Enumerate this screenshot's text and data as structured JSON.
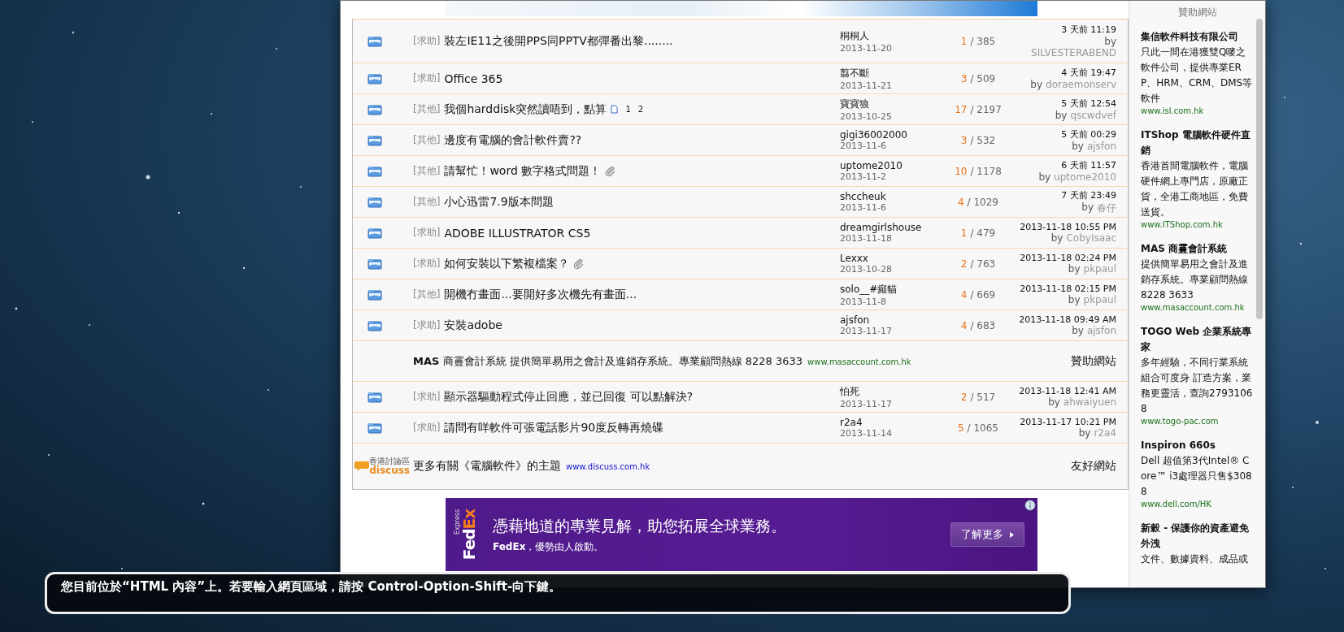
{
  "topics": [
    {
      "kind": "topic",
      "category": "[求助]",
      "title": "裝左IE11之後開PPS同PPTV都彈番出黎........",
      "author": "桐桐人",
      "date": "2013-11-20",
      "replies": "1",
      "views": "/ 385",
      "last_time": "3 天前 11:19",
      "by": "by",
      "last_user": "SILVESTERABEND"
    },
    {
      "kind": "topic",
      "category": "[求助]",
      "title": "Office 365",
      "author": "翦不斷",
      "date": "2013-11-21",
      "replies": "3",
      "views": "/ 509",
      "last_time": "4 天前 19:47",
      "by": "by",
      "last_user": "doraemonserv"
    },
    {
      "kind": "topic",
      "category": "[其他]",
      "title": "我個harddisk突然讀唔到，點算",
      "pages": [
        "1",
        "2"
      ],
      "author": "寶寶狼",
      "date": "2013-10-25",
      "replies": "17",
      "views": "/ 2197",
      "last_time": "5 天前 12:54",
      "by": "by",
      "last_user": "qscwdvef"
    },
    {
      "kind": "topic",
      "category": "[其他]",
      "title": "邊度有電腦的會計軟件賣??",
      "author": "gigi36002000",
      "date": "2013-11-6",
      "replies": "3",
      "views": "/ 532",
      "last_time": "5 天前 00:29",
      "by": "by",
      "last_user": "ajsfon"
    },
    {
      "kind": "topic",
      "category": "[其他]",
      "title": "請幫忙！word 數字格式問題！",
      "attachment": true,
      "author": "uptome2010",
      "date": "2013-11-2",
      "replies": "10",
      "views": "/ 1178",
      "last_time": "6 天前 11:57",
      "by": "by",
      "last_user": "uptome2010"
    },
    {
      "kind": "topic",
      "category": "[其他]",
      "title": "小心迅雷7.9版本問題",
      "author": "shccheuk",
      "date": "2013-11-6",
      "replies": "4",
      "views": "/ 1029",
      "last_time": "7 天前 23:49",
      "by": "by",
      "last_user": "春仔"
    },
    {
      "kind": "topic",
      "category": "[求助]",
      "title": "ADOBE ILLUSTRATOR CS5",
      "author": "dreamgirlshouse",
      "date": "2013-11-18",
      "replies": "1",
      "views": "/ 479",
      "last_time": "2013-11-18 10:55 PM",
      "by": "by",
      "last_user": "CobyIsaac"
    },
    {
      "kind": "topic",
      "category": "[求助]",
      "title": "如何安裝以下繁複檔案？",
      "attachment": true,
      "author": "Lexxx",
      "date": "2013-10-28",
      "replies": "2",
      "views": "/ 763",
      "last_time": "2013-11-18 02:24 PM",
      "by": "by",
      "last_user": "pkpaul"
    },
    {
      "kind": "topic",
      "category": "[其他]",
      "title": "開機冇畫面...要開好多次機先有畫面...",
      "author": "solo__#癲貓",
      "date": "2013-11-8",
      "replies": "4",
      "views": "/ 669",
      "last_time": "2013-11-18 02:15 PM",
      "by": "by",
      "last_user": "pkpaul"
    },
    {
      "kind": "topic",
      "category": "[求助]",
      "title": "安裝adobe",
      "author": "ajsfon",
      "date": "2013-11-17",
      "replies": "4",
      "views": "/ 683",
      "last_time": "2013-11-18 09:49 AM",
      "by": "by",
      "last_user": "ajsfon"
    },
    {
      "kind": "sponsor",
      "text": "**MAS** 商霻會計系統 提供簡單易用之會計及進銷存系統。專業顧問熱線 8228 3633",
      "url": "www.masaccount.com.hk",
      "label": "贊助網站"
    },
    {
      "kind": "topic",
      "category": "[求助]",
      "title": "顯示器驅動程式停止回應，並已回復 可以點解決?",
      "author": "怕死",
      "date": "2013-11-17",
      "replies": "2",
      "views": "/ 517",
      "last_time": "2013-11-18 12:41 AM",
      "by": "by",
      "last_user": "ahwaiyuen"
    },
    {
      "kind": "topic",
      "category": "[求助]",
      "title": "請問有咩軟件可張電話影片90度反轉再燒碟",
      "author": "r2a4",
      "date": "2013-11-14",
      "replies": "5",
      "views": "/ 1065",
      "last_time": "2013-11-17 10:21 PM",
      "by": "by",
      "last_user": "r2a4"
    }
  ],
  "footer": {
    "logo_top": "香港討論區",
    "logo_word": "discuss",
    "text": "更多有關《電腦軟件》的主題",
    "url": "www.discuss.com.hk",
    "label": "友好網站"
  },
  "ad": {
    "logo_parts": [
      "Fed",
      "Ex"
    ],
    "logo_sub": "Express",
    "headline": "憑藉地道的專業見解，助您拓展全球業務。",
    "sub": "**FedEx**，優勢由人啟動。",
    "button": "了解更多"
  },
  "sidebar": {
    "heading": "贊助網站",
    "items": [
      {
        "title": "集信軟件科技有限公司",
        "body": "只此一間在港獲雙Q嘜之軟件公司，提供專業ERP、HRM、CRM、DMS等軟件",
        "url": "www.isl.com.hk"
      },
      {
        "title": "ITShop 電腦軟件硬件直銷",
        "body": "香港首間電腦軟件，電腦硬件網上專門店，原廠正貨，全港工商地區，免費送貨。",
        "url": "www.ITShop.com.hk"
      },
      {
        "title": "MAS 商霻會計系統",
        "body": "提供簡單易用之會計及進銷存系統。專業顧問熱線 8228 3633",
        "url": "www.masaccount.com.hk"
      },
      {
        "title": "TOGO Web 企業系統專家",
        "body": "多年經驗，不同行業系統組合可度身 訂造方案，業務更靈活，查詢27931068",
        "url": "www.togo-pac.com"
      },
      {
        "title": "Inspiron 660s",
        "body": "Dell 超值第3代Intel® Core™ i3處理器只售$3088",
        "url": "www.dell.com/HK"
      },
      {
        "title": "新穀 - 保護你的資產避免外洩",
        "body": "文件、數據資料、成品或"
      }
    ]
  },
  "voiceover": {
    "text": "您目前位於“HTML 內容”上。若要輸入網頁區域，請按 Control-Option-Shift-向下鍵。"
  }
}
